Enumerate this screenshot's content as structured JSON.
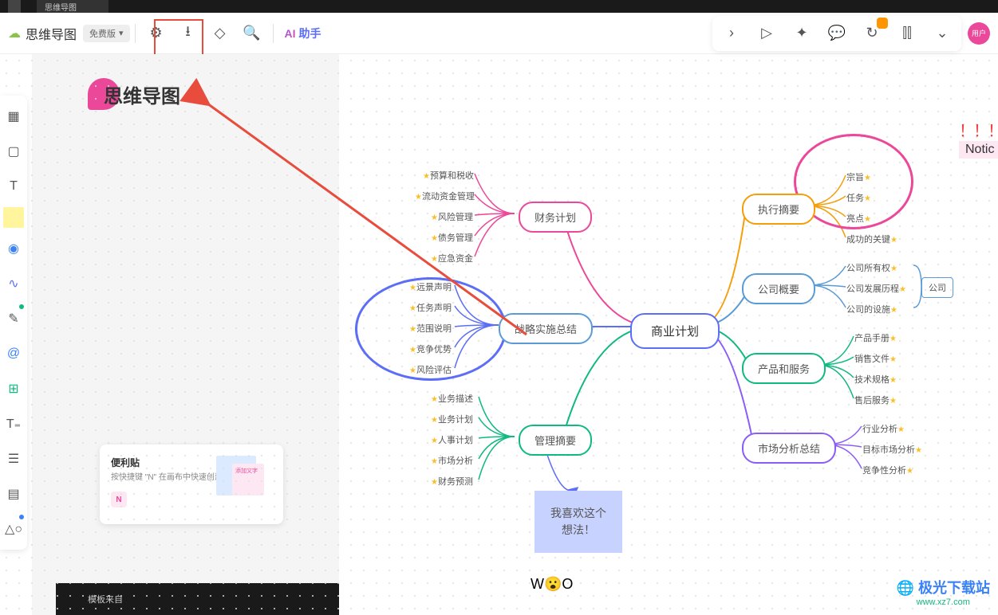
{
  "topbar": {
    "tab_title": "思维导图"
  },
  "toolbar": {
    "doc_title": "思维导图",
    "badge": "免费版",
    "ai_prefix": "AI",
    "ai_label": "助手",
    "user_label": "用户"
  },
  "left_panel": {
    "logo_text": "思维导图",
    "sticky_title": "便利贴",
    "sticky_desc": "按快捷键 \"N\" 在画布中快速创建便利贴",
    "sticky_key": "N",
    "sticky_preview_text": "添加文字",
    "template_from": "模板来自"
  },
  "mindmap": {
    "root": "商业计划",
    "nodes": {
      "finance": "财务计划",
      "strategy": "战略实施总结",
      "manage": "管理摘要",
      "exec": "执行摘要",
      "overview": "公司概要",
      "product": "产品和服务",
      "market": "市场分析总结",
      "company_box": "公司"
    },
    "leaves": {
      "finance": [
        "预算和税收",
        "流动资金管理",
        "风险管理",
        "债务管理",
        "应急资金"
      ],
      "strategy": [
        "远景声明",
        "任务声明",
        "范围说明",
        "竞争优势",
        "风险评估"
      ],
      "manage": [
        "业务描述",
        "业务计划",
        "人事计划",
        "市场分析",
        "财务预测"
      ],
      "exec": [
        "宗旨",
        "任务",
        "亮点",
        "成功的关键"
      ],
      "overview": [
        "公司所有权",
        "公司发展历程",
        "公司的设施"
      ],
      "product": [
        "产品手册",
        "销售文件",
        "技术规格",
        "售后服务"
      ],
      "market": [
        "行业分析",
        "目标市场分析",
        "竞争性分析"
      ]
    },
    "idea_text": "我喜欢这个想法！",
    "notice_text": "Notic",
    "emoji": "W😮O"
  },
  "watermark": {
    "name": "极光下载站",
    "url": "www.xz7.com"
  }
}
